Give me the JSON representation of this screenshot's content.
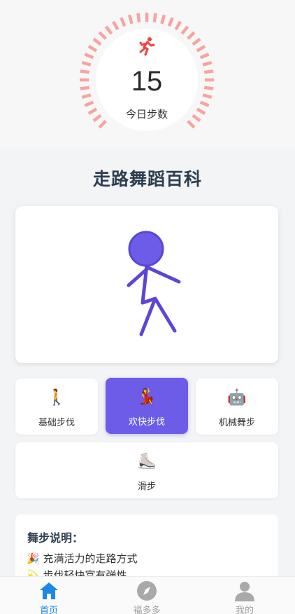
{
  "steps": {
    "count": "15",
    "caption": "今日步数",
    "ring_color": "#f7a4a0"
  },
  "title": "走路舞蹈百科",
  "animation": {
    "figure_color": "#5b46d6",
    "head_fill": "#6c5ce7"
  },
  "styles": [
    {
      "emoji": "🚶",
      "label": "基础步伐",
      "selected": false
    },
    {
      "emoji": "💃",
      "label": "欢快步伐",
      "selected": true
    },
    {
      "emoji": "🤖",
      "label": "机械舞步",
      "selected": false
    },
    {
      "emoji": "⛸️",
      "label": "滑步",
      "selected": false
    }
  ],
  "description": {
    "title": "舞步说明：",
    "lines": [
      {
        "emoji": "🎉",
        "text": "充满活力的走路方式"
      },
      {
        "emoji": "💫",
        "text": "步伐轻快富有弹性"
      }
    ]
  },
  "tabbar": {
    "items": [
      {
        "label": "首页",
        "icon": "home-icon",
        "active": true
      },
      {
        "label": "福多多",
        "icon": "compass-icon",
        "active": false
      },
      {
        "label": "我的",
        "icon": "person-icon",
        "active": false
      }
    ],
    "active_color": "#1e88e5"
  }
}
